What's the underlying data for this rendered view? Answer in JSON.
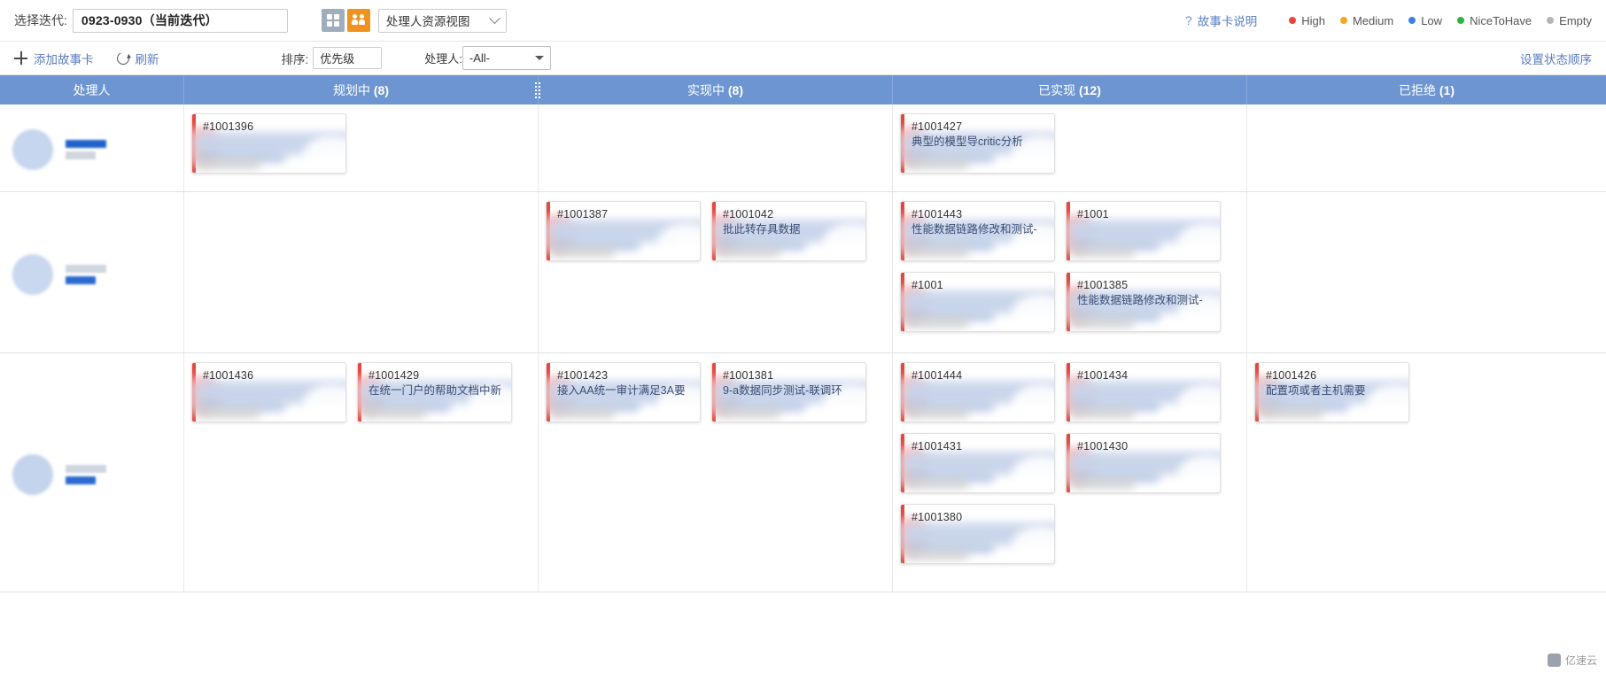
{
  "toolbar": {
    "iteration_label": "选择迭代:",
    "iteration_value": "0923-0930（当前迭代）",
    "view_value": "处理人资源视图",
    "help_text": "故事卡说明",
    "help_icon": "question-mark-icon",
    "legend": [
      {
        "label": "High",
        "color": "#e8453c"
      },
      {
        "label": "Medium",
        "color": "#f5a623"
      },
      {
        "label": "Low",
        "color": "#3b82e0"
      },
      {
        "label": "NiceToHave",
        "color": "#2fb344"
      },
      {
        "label": "Empty",
        "color": "#b4b4b4"
      }
    ]
  },
  "subtoolbar": {
    "add_card": "添加故事卡",
    "refresh": "刷新",
    "sort_label": "排序:",
    "sort_value": "优先级",
    "owner_label": "处理人:",
    "owner_value": "-All-",
    "status_order": "设置状态顺序"
  },
  "board": {
    "columns": [
      {
        "label": "处理人",
        "count": ""
      },
      {
        "label": "规划中",
        "count": "(8)"
      },
      {
        "label": "实现中",
        "count": "(8)"
      },
      {
        "label": "已实现",
        "count": "(12)"
      },
      {
        "label": "已拒绝",
        "count": "(1)"
      }
    ],
    "rows": [
      {
        "planning": [
          {
            "id": "#1001396",
            "title": "",
            "prio": "#e8453c"
          }
        ],
        "doing": [],
        "done": [
          {
            "id": "#1001427",
            "title": "典型的模型导critic分析",
            "prio": "#e8453c"
          }
        ],
        "rejected": []
      },
      {
        "planning": [],
        "doing": [
          {
            "id": "#1001387",
            "title": "",
            "prio": "#e8453c"
          },
          {
            "id": "#1001042",
            "title": "批此转存具数据",
            "prio": "#e8453c"
          }
        ],
        "done": [
          {
            "id": "#1001443",
            "title": "性能数据链路修改和测试-",
            "prio": "#e8453c"
          },
          {
            "id": "#1001",
            "title": "",
            "prio": "#e8453c"
          },
          {
            "id": "#1001",
            "title": "",
            "prio": "#e8453c"
          },
          {
            "id": "#1001385",
            "title": "性能数据链路修改和测试-",
            "prio": "#e8453c"
          }
        ],
        "rejected": []
      },
      {
        "planning": [
          {
            "id": "#1001436",
            "title": "",
            "prio": "#e8453c"
          },
          {
            "id": "#1001429",
            "title": "在统一门户的帮助文档中新",
            "prio": "#e8453c"
          }
        ],
        "doing": [
          {
            "id": "#1001423",
            "title": "接入AA统一审计满足3A要",
            "prio": "#e8453c"
          },
          {
            "id": "#1001381",
            "title": "9-a数据同步测试-联调环",
            "prio": "#e8453c"
          }
        ],
        "done": [
          {
            "id": "#1001444",
            "title": "",
            "prio": "#e8453c"
          },
          {
            "id": "#1001434",
            "title": "",
            "prio": "#e8453c"
          },
          {
            "id": "#1001431",
            "title": "",
            "prio": "#e8453c"
          },
          {
            "id": "#1001430",
            "title": "",
            "prio": "#e8453c"
          },
          {
            "id": "#1001380",
            "title": "",
            "prio": "#e8453c"
          }
        ],
        "rejected": [
          {
            "id": "#1001426",
            "title": "配置项或者主机需要",
            "prio": "#e8453c"
          }
        ]
      }
    ]
  },
  "watermark": {
    "text": "亿速云"
  }
}
